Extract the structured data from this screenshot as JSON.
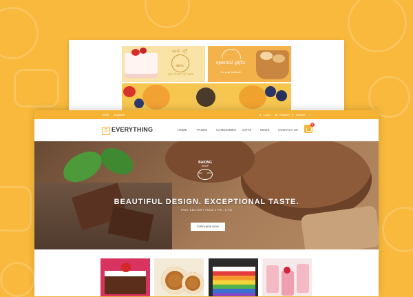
{
  "colors": {
    "accent": "#f5b233",
    "background": "#f8b93c",
    "sale": "#e9483d"
  },
  "promos": {
    "card1": {
      "line1": "sale off",
      "line2": "40%",
      "line3": "for lover of cake"
    },
    "card2": {
      "line1": "special gifts",
      "line2": "for your beloved"
    }
  },
  "topbar": {
    "currency": "USD",
    "language": "English",
    "links": [
      "Login",
      "Register",
      "Wishlist"
    ],
    "search_icon": "search-icon"
  },
  "brand": {
    "logo_letter": "S",
    "name": "EVERYTHING"
  },
  "nav": {
    "items": [
      "HOME",
      "PAGES",
      "CATEGORIES",
      "GIFTS",
      "NEWS",
      "CONTACT US"
    ]
  },
  "cart": {
    "count": "0",
    "icon": "cart-icon"
  },
  "hero": {
    "badge_top": "BAKING",
    "badge_mid": "SHOP",
    "badge_est": "Est.",
    "badge_year": "1974",
    "title": "BEAUTIFUL DESIGN. EXCEPTIONAL TASTE.",
    "subtitle": "FREE DELIVERY FROM 4 PM - 6 PM",
    "button": "PURCHASE NOW"
  },
  "thumbnails": [
    {
      "name": "strawberry-cake"
    },
    {
      "name": "swiss-roll"
    },
    {
      "name": "rainbow-cake"
    },
    {
      "name": "berry-cups"
    }
  ]
}
